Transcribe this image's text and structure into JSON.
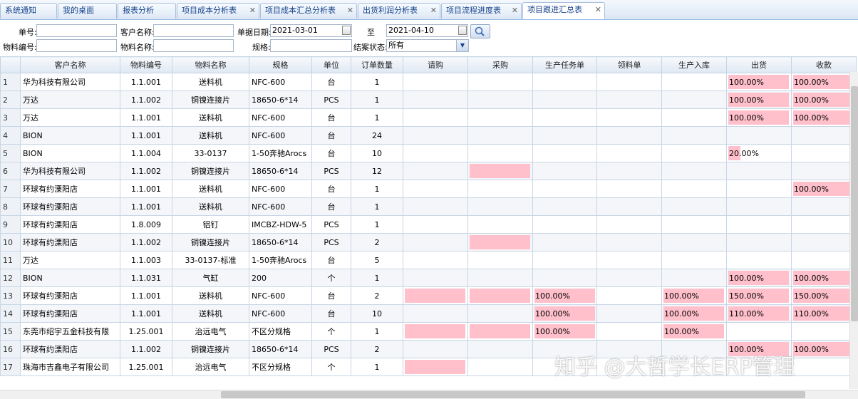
{
  "tabs": [
    {
      "label": "系统通知",
      "closable": false,
      "active": false
    },
    {
      "label": "我的桌面",
      "closable": false,
      "active": false
    },
    {
      "label": "报表分析",
      "closable": false,
      "active": false
    },
    {
      "label": "项目成本分析表",
      "closable": true,
      "active": false
    },
    {
      "label": "项目成本汇总分析表",
      "closable": true,
      "active": false
    },
    {
      "label": "出货利润分析表",
      "closable": true,
      "active": false
    },
    {
      "label": "项目流程进度表",
      "closable": true,
      "active": false
    },
    {
      "label": "项目跟进汇总表",
      "closable": true,
      "active": true
    }
  ],
  "close_glyph": "✕",
  "filters": {
    "order_no_label": "单号:",
    "customer_label": "客户名称:",
    "date_label": "单据日期:",
    "date_from": "2021-03-01",
    "to_label": "至",
    "date_to": "2021-04-10",
    "material_code_label": "物料编号:",
    "material_name_label": "物料名称:",
    "spec_label": "规格:",
    "status_label": "结案状态:",
    "status_value": "所有"
  },
  "columns": [
    "",
    "客户名称",
    "物料编号",
    "物料名称",
    "规格",
    "单位",
    "订单数量",
    "请购",
    "采购",
    "生产任务单",
    "领料单",
    "生产入库",
    "出货",
    "收款"
  ],
  "rows": [
    {
      "n": "1",
      "customer": "华为科技有限公司",
      "code": "1.1.001",
      "name": "送料机",
      "spec": "NFC-600",
      "unit": "台",
      "qty": "1",
      "pr": null,
      "po": null,
      "task": null,
      "pick": null,
      "inbound": null,
      "ship": {
        "text": "100.00%",
        "fill": 1.0
      },
      "pay": {
        "text": "100.00%",
        "fill": 1.0
      }
    },
    {
      "n": "2",
      "customer": "万达",
      "code": "1.1.002",
      "name": "铜镍连接片",
      "spec": "18650-6*14",
      "unit": "PCS",
      "qty": "1",
      "pr": null,
      "po": null,
      "task": null,
      "pick": null,
      "inbound": null,
      "ship": {
        "text": "100.00%",
        "fill": 1.0
      },
      "pay": {
        "text": "100.00%",
        "fill": 1.0
      }
    },
    {
      "n": "3",
      "customer": "万达",
      "code": "1.1.001",
      "name": "送料机",
      "spec": "NFC-600",
      "unit": "台",
      "qty": "1",
      "pr": null,
      "po": null,
      "task": null,
      "pick": null,
      "inbound": null,
      "ship": {
        "text": "100.00%",
        "fill": 1.0
      },
      "pay": {
        "text": "100.00%",
        "fill": 1.0
      }
    },
    {
      "n": "4",
      "customer": "BION",
      "code": "1.1.001",
      "name": "送料机",
      "spec": "NFC-600",
      "unit": "台",
      "qty": "24",
      "pr": null,
      "po": null,
      "task": null,
      "pick": null,
      "inbound": null,
      "ship": null,
      "pay": null
    },
    {
      "n": "5",
      "customer": "BION",
      "code": "1.1.004",
      "name": "33-0137",
      "spec": "1-50奔驰Arocs",
      "unit": "台",
      "qty": "10",
      "pr": null,
      "po": null,
      "task": null,
      "pick": null,
      "inbound": null,
      "ship": {
        "text": "20.00%",
        "fill": 0.2
      },
      "pay": null
    },
    {
      "n": "6",
      "customer": "华为科技有限公司",
      "code": "1.1.002",
      "name": "铜镍连接片",
      "spec": "18650-6*14",
      "unit": "PCS",
      "qty": "12",
      "pr": null,
      "po": {
        "text": "",
        "fill": 1.0
      },
      "task": null,
      "pick": null,
      "inbound": null,
      "ship": null,
      "pay": null
    },
    {
      "n": "7",
      "customer": "环球有约溧阳店",
      "code": "1.1.001",
      "name": "送料机",
      "spec": "NFC-600",
      "unit": "台",
      "qty": "1",
      "pr": null,
      "po": null,
      "task": null,
      "pick": null,
      "inbound": null,
      "ship": null,
      "pay": {
        "text": "100.00%",
        "fill": 1.0
      }
    },
    {
      "n": "8",
      "customer": "环球有约溧阳店",
      "code": "1.1.001",
      "name": "送料机",
      "spec": "NFC-600",
      "unit": "台",
      "qty": "1",
      "pr": null,
      "po": null,
      "task": null,
      "pick": null,
      "inbound": null,
      "ship": null,
      "pay": null
    },
    {
      "n": "9",
      "customer": "环球有约溧阳店",
      "code": "1.8.009",
      "name": "铝钉",
      "spec": "IMCBZ-HDW-5",
      "unit": "PCS",
      "qty": "1",
      "pr": null,
      "po": null,
      "task": null,
      "pick": null,
      "inbound": null,
      "ship": null,
      "pay": null
    },
    {
      "n": "10",
      "customer": "环球有约溧阳店",
      "code": "1.1.002",
      "name": "铜镍连接片",
      "spec": "18650-6*14",
      "unit": "PCS",
      "qty": "2",
      "pr": null,
      "po": {
        "text": "",
        "fill": 1.0
      },
      "task": null,
      "pick": null,
      "inbound": null,
      "ship": null,
      "pay": null
    },
    {
      "n": "11",
      "customer": "万达",
      "code": "1.1.003",
      "name": "33-0137-标准",
      "spec": "1-50奔驰Arocs",
      "unit": "台",
      "qty": "5",
      "pr": null,
      "po": null,
      "task": null,
      "pick": null,
      "inbound": null,
      "ship": null,
      "pay": null
    },
    {
      "n": "12",
      "customer": "BION",
      "code": "1.1.031",
      "name": "气缸",
      "spec": "200",
      "unit": "个",
      "qty": "1",
      "pr": null,
      "po": null,
      "task": null,
      "pick": null,
      "inbound": null,
      "ship": {
        "text": "100.00%",
        "fill": 1.0
      },
      "pay": {
        "text": "100.00%",
        "fill": 1.0
      }
    },
    {
      "n": "13",
      "customer": "环球有约溧阳店",
      "code": "1.1.001",
      "name": "送料机",
      "spec": "NFC-600",
      "unit": "台",
      "qty": "2",
      "pr": {
        "text": "",
        "fill": 1.0
      },
      "po": {
        "text": "",
        "fill": 1.0
      },
      "task": {
        "text": "100.00%",
        "fill": 1.0
      },
      "pick": null,
      "inbound": {
        "text": "100.00%",
        "fill": 1.0
      },
      "ship": {
        "text": "150.00%",
        "fill": 1.0
      },
      "pay": {
        "text": "150.00%",
        "fill": 1.0
      }
    },
    {
      "n": "14",
      "customer": "环球有约溧阳店",
      "code": "1.1.001",
      "name": "送料机",
      "spec": "NFC-600",
      "unit": "台",
      "qty": "10",
      "pr": null,
      "po": null,
      "task": {
        "text": "100.00%",
        "fill": 1.0
      },
      "pick": null,
      "inbound": {
        "text": "100.00%",
        "fill": 1.0
      },
      "ship": {
        "text": "110.00%",
        "fill": 1.0
      },
      "pay": {
        "text": "110.00%",
        "fill": 1.0
      }
    },
    {
      "n": "15",
      "customer": "东莞市绍宇五金科技有限",
      "code": "1.25.001",
      "name": "治远电气",
      "spec": "不区分规格",
      "unit": "个",
      "qty": "1",
      "pr": {
        "text": "",
        "fill": 1.0
      },
      "po": {
        "text": "",
        "fill": 1.0
      },
      "task": {
        "text": "100.00%",
        "fill": 1.0
      },
      "pick": null,
      "inbound": {
        "text": "100.00%",
        "fill": 1.0
      },
      "ship": null,
      "pay": null
    },
    {
      "n": "16",
      "customer": "环球有约溧阳店",
      "code": "1.1.002",
      "name": "铜镍连接片",
      "spec": "18650-6*14",
      "unit": "PCS",
      "qty": "2",
      "pr": null,
      "po": null,
      "task": null,
      "pick": null,
      "inbound": null,
      "ship": {
        "text": "100.00%",
        "fill": 1.0
      },
      "pay": {
        "text": "100.00%",
        "fill": 1.0
      }
    },
    {
      "n": "17",
      "customer": "珠海市吉鑫电子有限公司",
      "code": "1.25.001",
      "name": "治远电气",
      "spec": "不区分规格",
      "unit": "个",
      "qty": "1",
      "pr": {
        "text": "",
        "fill": 1.0
      },
      "po": null,
      "task": null,
      "pick": null,
      "inbound": null,
      "ship": null,
      "pay": null
    }
  ],
  "colors": {
    "highlight": "#ffc0cb",
    "header": "#dfe8f3",
    "tab_text": "#15428b"
  },
  "watermark": "知乎 @大哲学长ERP管理"
}
